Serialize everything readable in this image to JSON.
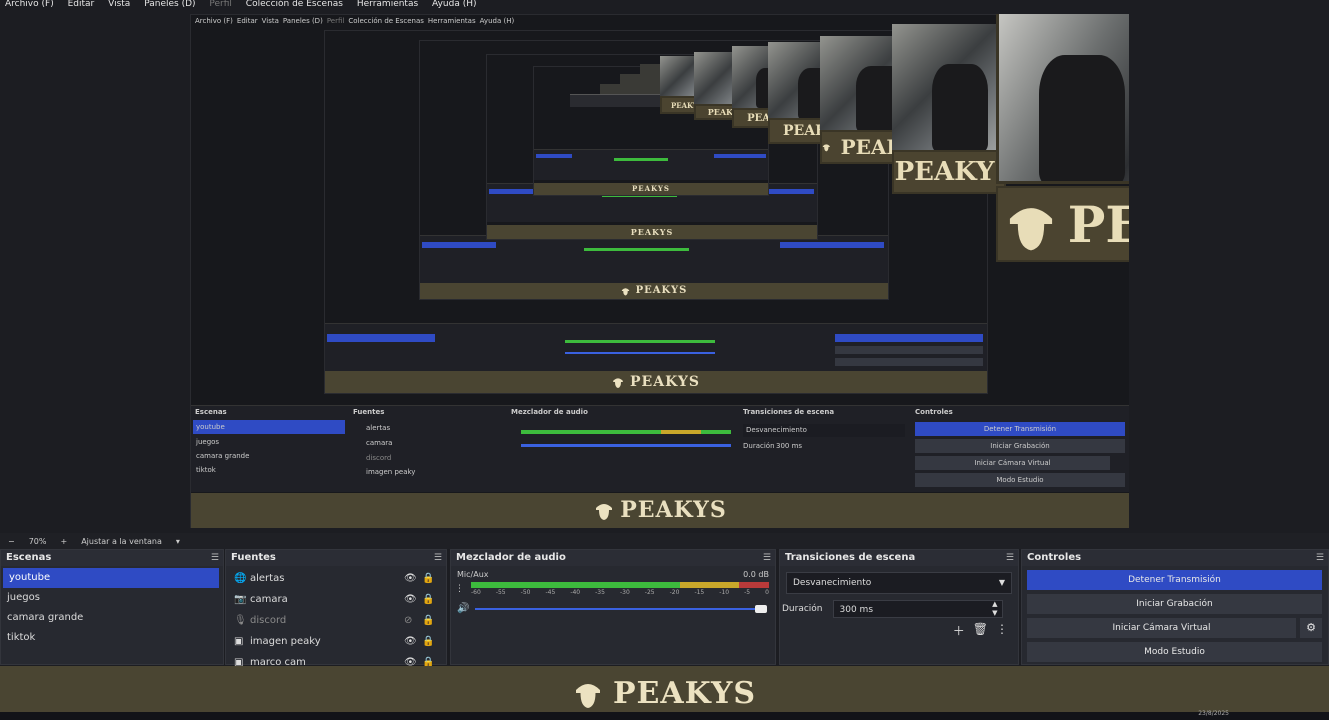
{
  "menu": {
    "items": [
      "Archivo (F)",
      "Editar",
      "Vista",
      "Paneles (D)",
      "Perfil",
      "Colección de Escenas",
      "Herramientas",
      "Ayuda (H)"
    ]
  },
  "brand": {
    "logo_text": "PEAKYS"
  },
  "zoombar": {
    "minus": "−",
    "zoom": "70%",
    "plus": "+",
    "fit": "Ajustar a la ventana",
    "caret": "▾"
  },
  "docks": {
    "scenes": {
      "title": "Escenas",
      "items": [
        "youtube",
        "juegos",
        "camara grande",
        "tiktok"
      ]
    },
    "sources": {
      "title": "Fuentes",
      "items": [
        {
          "label": "alertas",
          "icon": "globe-icon"
        },
        {
          "label": "camara",
          "icon": "camera-icon"
        },
        {
          "label": "discord",
          "icon": "mic-icon"
        },
        {
          "label": "imagen peaky",
          "icon": "image-icon"
        },
        {
          "label": "marco cam",
          "icon": "image-icon"
        }
      ]
    },
    "mixer": {
      "title": "Mezclador de audio",
      "channel": "Mic/Aux",
      "db": "0.0 dB",
      "ticks": [
        "-60",
        "-55",
        "-50",
        "-45",
        "-40",
        "-35",
        "-30",
        "-25",
        "-20",
        "-15",
        "-10",
        "-5",
        "0"
      ]
    },
    "transitions": {
      "title": "Transiciones de escena",
      "selected": "Desvanecimiento",
      "duration_label": "Duración",
      "duration_value": "300 ms"
    },
    "controls": {
      "title": "Controles",
      "buttons": [
        "Detener Transmisión",
        "Iniciar Grabación",
        "Iniciar Cámara Virtual",
        "Modo Estudio"
      ]
    }
  },
  "taskbar": {
    "date": "23/8/2025"
  },
  "colors": {
    "accent": "#2f4bc4",
    "banner": "#4a4532",
    "meter_green": "#3dbb3d",
    "meter_yellow": "#c9a72a",
    "meter_red": "#b83a3a"
  }
}
